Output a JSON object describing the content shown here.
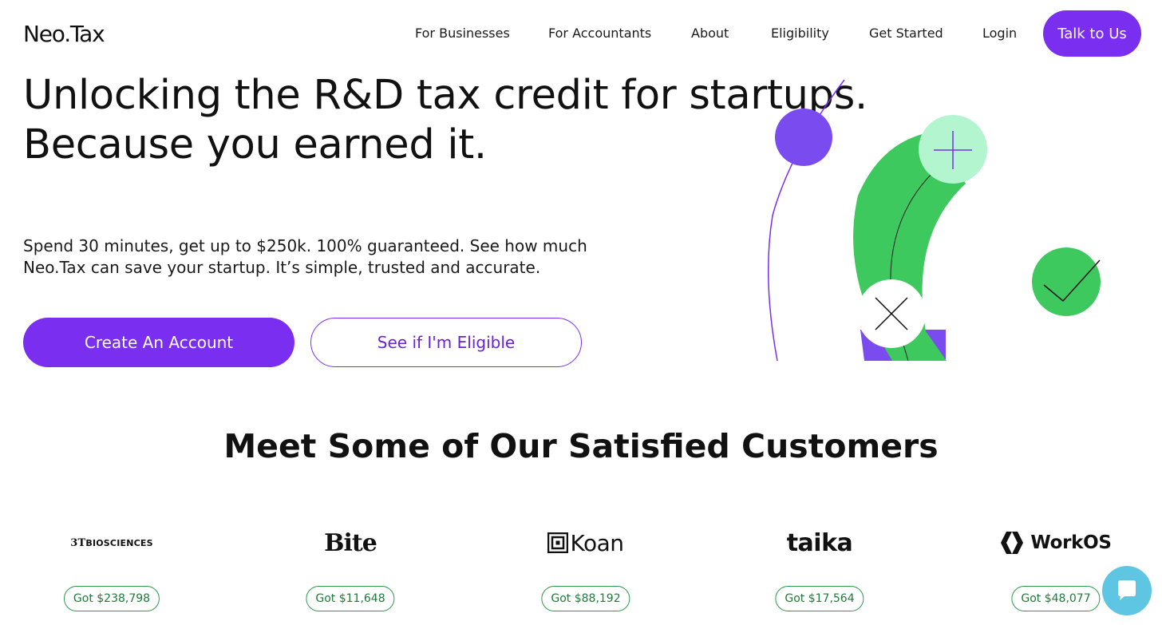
{
  "header": {
    "logo": "Neo.Tax",
    "nav": [
      "For Businesses",
      "For Accountants",
      "About",
      "Eligibility",
      "Get Started",
      "Login"
    ],
    "cta": "Talk to Us"
  },
  "hero": {
    "title_line1": "Unlocking the R&D tax credit for startups.",
    "title_line2": "Because you earned it.",
    "subtitle_line1": "Spend 30 minutes, get up to $250k. 100% guaranteed. See how much",
    "subtitle_line2": "Neo.Tax can save your startup. It’s simple, trusted and accurate.",
    "primary_button": "Create An Account",
    "secondary_button": "See if I'm Eligible"
  },
  "customers": {
    "title": "Meet Some of Our Satisfied Customers",
    "items": [
      {
        "logo_prefix": "3T",
        "logo_text": "BIOSCIENCES",
        "badge": "Got $238,798"
      },
      {
        "logo_text": "Bite",
        "badge": "Got $11,648"
      },
      {
        "logo_text": "Koan",
        "badge": "Got $88,192"
      },
      {
        "logo_text": "taika",
        "badge": "Got $17,564"
      },
      {
        "logo_text": "WorkOS",
        "badge": "Got $48,077"
      }
    ]
  },
  "colors": {
    "brand_purple": "#7a2ef0",
    "green": "#3ec95f",
    "mint": "#b3f5cf",
    "chat": "#5ec6e3",
    "badge_green": "#2e9a4e"
  },
  "icons": [
    "plus-icon",
    "close-icon",
    "check-icon",
    "chat-icon"
  ]
}
